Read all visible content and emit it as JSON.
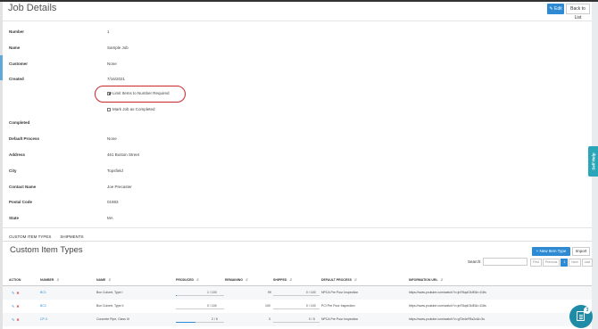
{
  "header": {
    "title": "Job Details",
    "edit_label": "Edit",
    "edit_icon": "pencil-icon",
    "back_label": "Back to List"
  },
  "details": [
    {
      "label": "Number",
      "value": "1"
    },
    {
      "label": "Name",
      "value": "Sample Job"
    },
    {
      "label": "Customer",
      "value": "None"
    },
    {
      "label": "Created",
      "value": "7/16/2021"
    },
    {
      "label": "Completed",
      "value": ""
    },
    {
      "label": "Default Process",
      "value": "None"
    },
    {
      "label": "Address",
      "value": "461 Boston Street"
    },
    {
      "label": "City",
      "value": "Topsfield"
    },
    {
      "label": "Contact Name",
      "value": "Joe Precaster"
    },
    {
      "label": "Postal Code",
      "value": "01983"
    },
    {
      "label": "State",
      "value": "MA"
    }
  ],
  "checkboxes": {
    "limit_items": {
      "label": "Limit Items to Number Required",
      "checked": true
    },
    "mark_completed": {
      "label": "Mark Job as Completed",
      "checked": false
    }
  },
  "highlight_color": "#c9262b",
  "tabs": [
    {
      "label": "CUSTOM ITEM TYPES",
      "active": true
    },
    {
      "label": "SHIPMENTS",
      "active": false
    }
  ],
  "section": {
    "title": "Custom Item Types",
    "new_button": "+ New Item Type",
    "import_button": "Import",
    "search_label": "Search:",
    "pager": [
      "First",
      "Previous",
      "1",
      "Next",
      "Last"
    ]
  },
  "table": {
    "headers": [
      "ACTION",
      "NUMBER",
      "NAME",
      "PRODUCED",
      "REMAINING",
      "SHIPPED",
      "DEFAULT PROCESS",
      "INFORMATION URL"
    ],
    "rows": [
      {
        "number": "BC1",
        "name": "Box Culvert, Type I",
        "produced": "1 / 100",
        "produced_fraction": 0.01,
        "remaining": "99",
        "shipped": "0 / 100",
        "shipped_fraction": 0,
        "process": "NPCA Pre Pour Inspection",
        "url": "https://www.youtube.com/watch?v=jnf76qdOkIE&t=118s"
      },
      {
        "number": "BC2",
        "name": "Box Culvert, Type II",
        "produced": "0 / 100",
        "produced_fraction": 0,
        "remaining": "100",
        "shipped": "0 / 100",
        "shipped_fraction": 0,
        "process": "PCI Pre Pour Inspection",
        "url": "https://www.youtube.com/watch?v=jnf76qdOkIE&t=118s"
      },
      {
        "number": "CP-3",
        "name": "Concrete Pipe, Class III",
        "produced": "2 / 5",
        "produced_fraction": 0.4,
        "remaining": "3",
        "shipped": "0 / 5",
        "shipped_fraction": 0,
        "process": "NPCA Pre Pour Inspection",
        "url": "https://www.youtube.com/watch?v=gTAr4eFBs2c&t=3s"
      }
    ]
  },
  "self_help": {
    "label": "Self Help"
  },
  "chat": {
    "badge": "3"
  },
  "colors": {
    "accent": "#2e8bd3",
    "selfhelp": "#2aa6b8",
    "chat": "#1f8ba6"
  }
}
